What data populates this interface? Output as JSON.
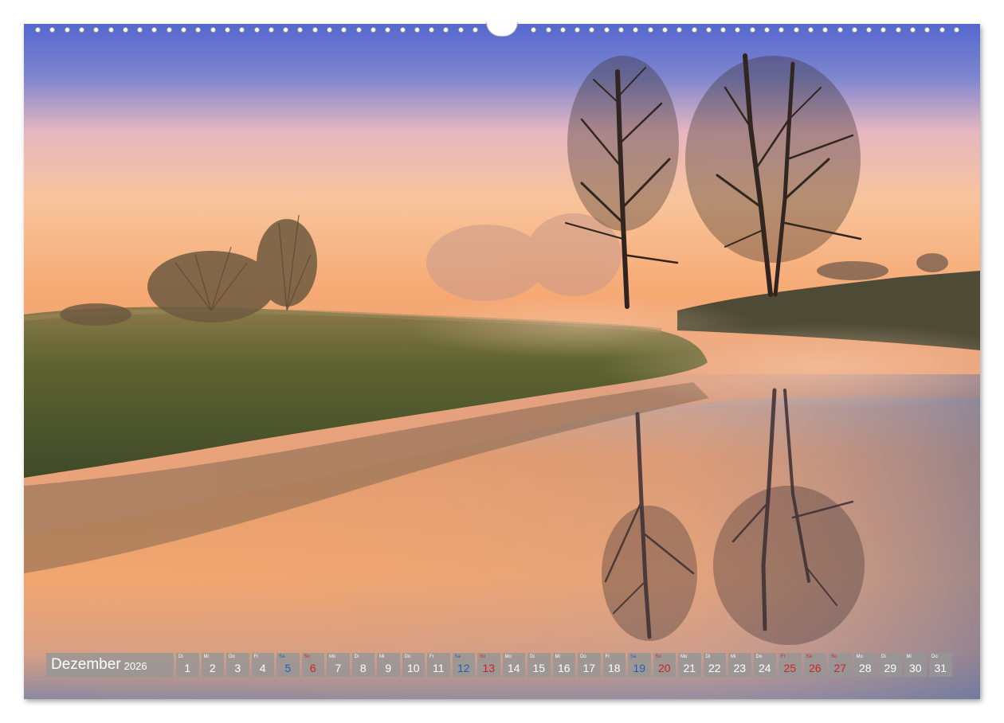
{
  "calendar": {
    "month": "Dezember",
    "year": "2026",
    "days": [
      {
        "wd": "Di",
        "num": "1",
        "kind": "weekday"
      },
      {
        "wd": "Mi",
        "num": "2",
        "kind": "weekday"
      },
      {
        "wd": "Do",
        "num": "3",
        "kind": "weekday"
      },
      {
        "wd": "Fr",
        "num": "4",
        "kind": "weekday"
      },
      {
        "wd": "Sa",
        "num": "5",
        "kind": "sat"
      },
      {
        "wd": "So",
        "num": "6",
        "kind": "sun"
      },
      {
        "wd": "Mo",
        "num": "7",
        "kind": "weekday"
      },
      {
        "wd": "Di",
        "num": "8",
        "kind": "weekday"
      },
      {
        "wd": "Mi",
        "num": "9",
        "kind": "weekday"
      },
      {
        "wd": "Do",
        "num": "10",
        "kind": "weekday"
      },
      {
        "wd": "Fr",
        "num": "11",
        "kind": "weekday"
      },
      {
        "wd": "Sa",
        "num": "12",
        "kind": "sat"
      },
      {
        "wd": "So",
        "num": "13",
        "kind": "sun"
      },
      {
        "wd": "Mo",
        "num": "14",
        "kind": "weekday"
      },
      {
        "wd": "Di",
        "num": "15",
        "kind": "weekday"
      },
      {
        "wd": "Mi",
        "num": "16",
        "kind": "weekday"
      },
      {
        "wd": "Do",
        "num": "17",
        "kind": "weekday"
      },
      {
        "wd": "Fr",
        "num": "18",
        "kind": "weekday"
      },
      {
        "wd": "Sa",
        "num": "19",
        "kind": "sat"
      },
      {
        "wd": "So",
        "num": "20",
        "kind": "sun"
      },
      {
        "wd": "Mo",
        "num": "21",
        "kind": "weekday"
      },
      {
        "wd": "Di",
        "num": "22",
        "kind": "weekday"
      },
      {
        "wd": "Mi",
        "num": "23",
        "kind": "weekday"
      },
      {
        "wd": "Do",
        "num": "24",
        "kind": "weekday"
      },
      {
        "wd": "Fr",
        "num": "25",
        "kind": "holiday"
      },
      {
        "wd": "Sa",
        "num": "26",
        "kind": "holiday"
      },
      {
        "wd": "So",
        "num": "27",
        "kind": "sun"
      },
      {
        "wd": "Mo",
        "num": "28",
        "kind": "weekday"
      },
      {
        "wd": "Di",
        "num": "29",
        "kind": "weekday"
      },
      {
        "wd": "Mi",
        "num": "30",
        "kind": "weekday"
      },
      {
        "wd": "Do",
        "num": "31",
        "kind": "weekday"
      }
    ]
  },
  "colors": {
    "sky_top": "#5a6fd0",
    "sky_mid": "#f6b98a",
    "sky_low": "#f4a26a",
    "water": "#f0a770",
    "water_deep": "#7d7f98",
    "bank": "#5a5a2e",
    "tree": "#2e2520",
    "saturday": "#1c63b7",
    "sunday": "#d42020",
    "strip_box": "#969696"
  }
}
